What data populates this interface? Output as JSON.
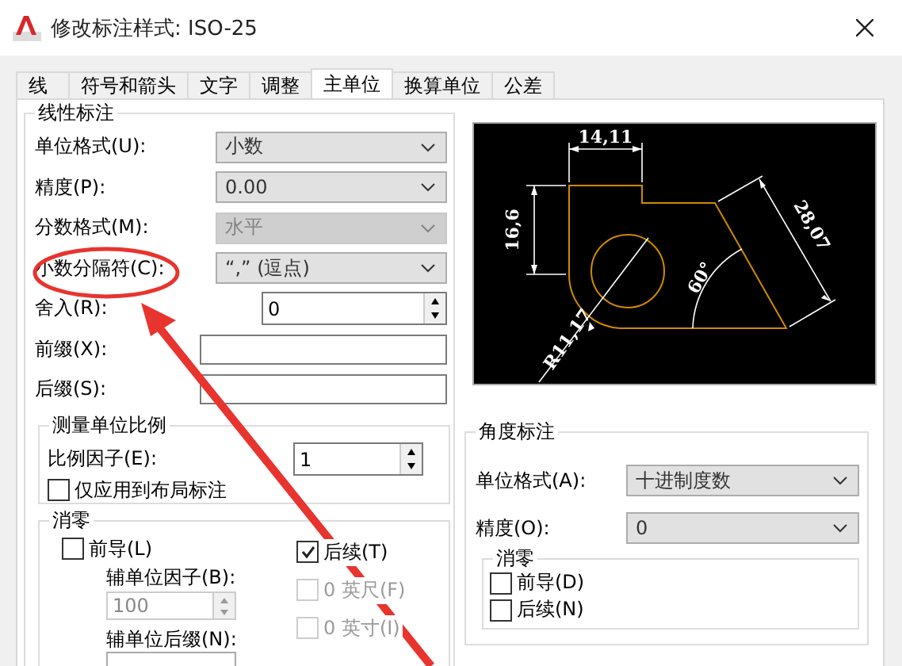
{
  "window": {
    "title": "修改标注样式: ISO-25"
  },
  "tabs": [
    {
      "label": "线",
      "selected": false
    },
    {
      "label": "符号和箭头",
      "selected": false
    },
    {
      "label": "文字",
      "selected": false
    },
    {
      "label": "调整",
      "selected": false
    },
    {
      "label": "主单位",
      "selected": true
    },
    {
      "label": "换算单位",
      "selected": false
    },
    {
      "label": "公差",
      "selected": false
    }
  ],
  "linear": {
    "title": "线性标注",
    "fields": [
      {
        "kind": "combo",
        "label": "单位格式(U):",
        "value": "小数",
        "disabled": false
      },
      {
        "kind": "combo",
        "label": "精度(P):",
        "value": "0.00",
        "disabled": false
      },
      {
        "kind": "combo",
        "label": "分数格式(M):",
        "value": "水平",
        "disabled": true
      },
      {
        "kind": "combo",
        "label": "小数分隔符(C):",
        "value": "“,” (逗点)",
        "disabled": false
      },
      {
        "kind": "spin",
        "label": "舍入(R):",
        "value": "0"
      },
      {
        "kind": "text",
        "label": "前缀(X):"
      },
      {
        "kind": "text",
        "label": "后缀(S):"
      }
    ]
  },
  "scale": {
    "title": "测量单位比例",
    "factor_label": "比例因子(E):",
    "factor_value": "1",
    "layout_only": {
      "label": "仅应用到布局标注",
      "checked": false
    }
  },
  "zero": {
    "title": "消零",
    "leading": {
      "label": "前导(L)",
      "checked": false
    },
    "sub_factor_label": "辅单位因子(B):",
    "sub_factor_value": "100",
    "sub_suffix_label": "辅单位后缀(N):",
    "trailing": {
      "label": "后续(T)",
      "checked": true,
      "disabled": false
    },
    "feet": {
      "label": "0 英尺(F)",
      "checked": false,
      "disabled": true
    },
    "inches": {
      "label": "0 英寸(I)",
      "checked": false,
      "disabled": true
    }
  },
  "preview": {
    "labels": [
      "14,11",
      "16,6",
      "28,07",
      "60°",
      "R11,17"
    ]
  },
  "angular": {
    "title": "角度标注",
    "fields": [
      {
        "kind": "combo",
        "label": "单位格式(A):",
        "value": "十进制度数",
        "disabled": false
      },
      {
        "kind": "combo",
        "label": "精度(O):",
        "value": "0",
        "disabled": false
      }
    ],
    "zero": {
      "title": "消零",
      "options": [
        {
          "label": "前导(D)",
          "checked": false
        },
        {
          "label": "后续(N)",
          "checked": false
        }
      ]
    }
  }
}
